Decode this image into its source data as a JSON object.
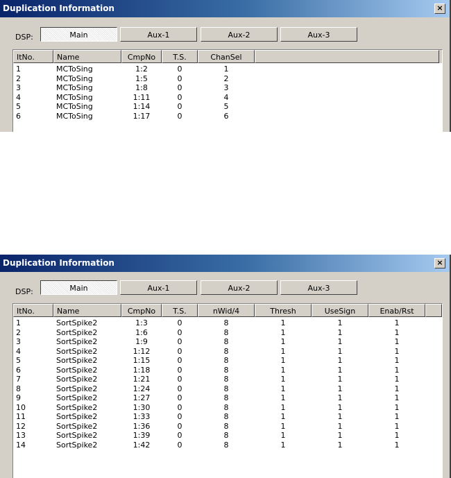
{
  "dialogs": [
    {
      "title": "Duplication Information",
      "close_glyph": "×",
      "dsp_label": "DSP:",
      "tabs": [
        "Main",
        "Aux-1",
        "Aux-2",
        "Aux-3"
      ],
      "selected_tab": "Main",
      "columns": [
        "ItNo.",
        "Name",
        "CmpNo",
        "T.S.",
        "ChanSel"
      ],
      "rows": [
        [
          "1",
          "MCToSing",
          "1:2",
          "0",
          "1"
        ],
        [
          "2",
          "MCToSing",
          "1:5",
          "0",
          "2"
        ],
        [
          "3",
          "MCToSing",
          "1:8",
          "0",
          "3"
        ],
        [
          "4",
          "MCToSing",
          "1:11",
          "0",
          "4"
        ],
        [
          "5",
          "MCToSing",
          "1:14",
          "0",
          "5"
        ],
        [
          "6",
          "MCToSing",
          "1:17",
          "0",
          "6"
        ]
      ]
    },
    {
      "title": "Duplication Information",
      "close_glyph": "×",
      "dsp_label": "DSP:",
      "tabs": [
        "Main",
        "Aux-1",
        "Aux-2",
        "Aux-3"
      ],
      "selected_tab": "Main",
      "columns": [
        "ItNo.",
        "Name",
        "CmpNo",
        "T.S.",
        "nWid/4",
        "Thresh",
        "UseSign",
        "Enab/Rst"
      ],
      "rows": [
        [
          "1",
          "SortSpike2",
          "1:3",
          "0",
          "8",
          "1",
          "1",
          "1"
        ],
        [
          "2",
          "SortSpike2",
          "1:6",
          "0",
          "8",
          "1",
          "1",
          "1"
        ],
        [
          "3",
          "SortSpike2",
          "1:9",
          "0",
          "8",
          "1",
          "1",
          "1"
        ],
        [
          "4",
          "SortSpike2",
          "1:12",
          "0",
          "8",
          "1",
          "1",
          "1"
        ],
        [
          "5",
          "SortSpike2",
          "1:15",
          "0",
          "8",
          "1",
          "1",
          "1"
        ],
        [
          "6",
          "SortSpike2",
          "1:18",
          "0",
          "8",
          "1",
          "1",
          "1"
        ],
        [
          "7",
          "SortSpike2",
          "1:21",
          "0",
          "8",
          "1",
          "1",
          "1"
        ],
        [
          "8",
          "SortSpike2",
          "1:24",
          "0",
          "8",
          "1",
          "1",
          "1"
        ],
        [
          "9",
          "SortSpike2",
          "1:27",
          "0",
          "8",
          "1",
          "1",
          "1"
        ],
        [
          "10",
          "SortSpike2",
          "1:30",
          "0",
          "8",
          "1",
          "1",
          "1"
        ],
        [
          "11",
          "SortSpike2",
          "1:33",
          "0",
          "8",
          "1",
          "1",
          "1"
        ],
        [
          "12",
          "SortSpike2",
          "1:36",
          "0",
          "8",
          "1",
          "1",
          "1"
        ],
        [
          "13",
          "SortSpike2",
          "1:39",
          "0",
          "8",
          "1",
          "1",
          "1"
        ],
        [
          "14",
          "SortSpike2",
          "1:42",
          "0",
          "8",
          "1",
          "1",
          "1"
        ]
      ]
    }
  ]
}
